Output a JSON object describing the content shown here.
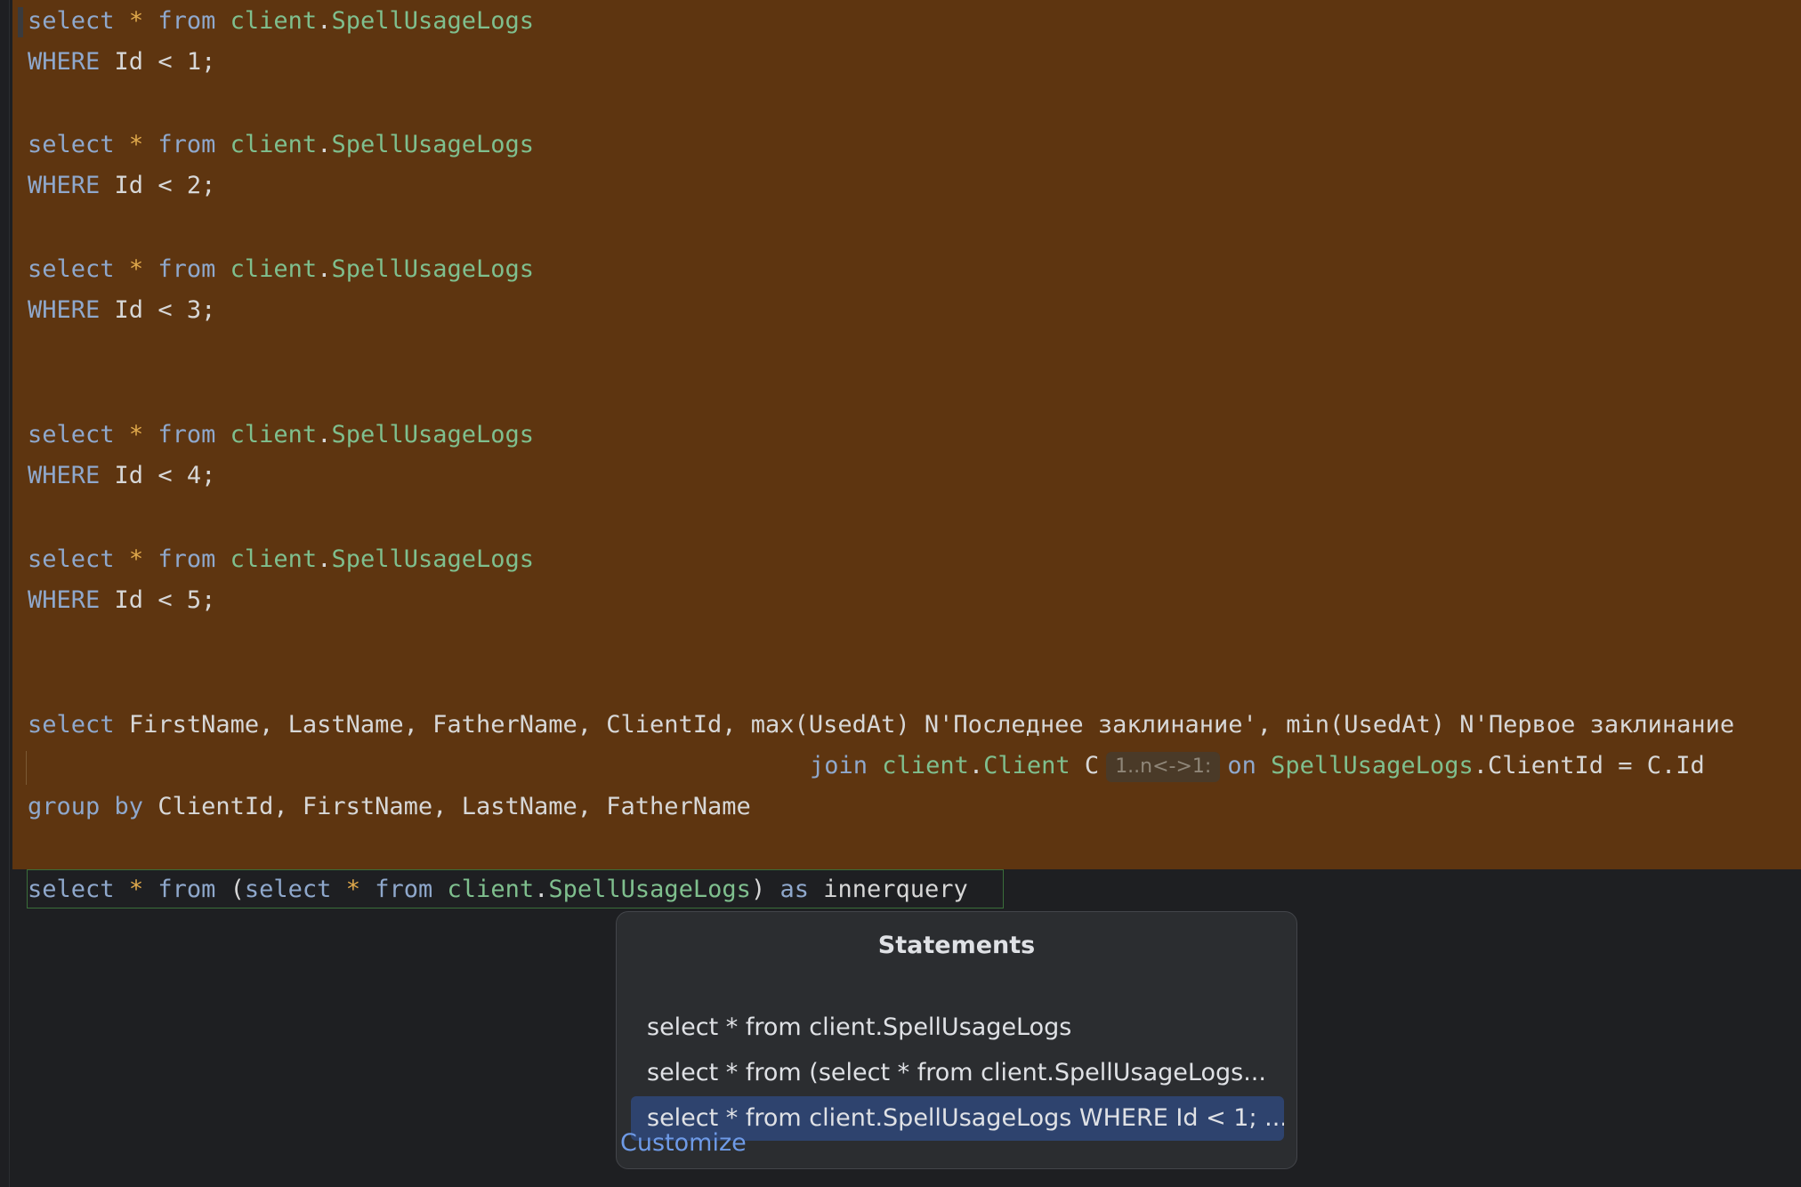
{
  "editor": {
    "lines": [
      {
        "kw1": "select",
        "star": "*",
        "kw2": "from",
        "schema": "client",
        "table": "SpellUsageLogs"
      },
      {
        "kw": "WHERE",
        "col": "Id",
        "op": "<",
        "val": "1;"
      },
      {
        "kw1": "select",
        "star": "*",
        "kw2": "from",
        "schema": "client",
        "table": "SpellUsageLogs"
      },
      {
        "kw": "WHERE",
        "col": "Id",
        "op": "<",
        "val": "2;"
      },
      {
        "kw1": "select",
        "star": "*",
        "kw2": "from",
        "schema": "client",
        "table": "SpellUsageLogs"
      },
      {
        "kw": "WHERE",
        "col": "Id",
        "op": "<",
        "val": "3;"
      },
      {
        "kw1": "select",
        "star": "*",
        "kw2": "from",
        "schema": "client",
        "table": "SpellUsageLogs"
      },
      {
        "kw": "WHERE",
        "col": "Id",
        "op": "<",
        "val": "4;"
      },
      {
        "kw1": "select",
        "star": "*",
        "kw2": "from",
        "schema": "client",
        "table": "SpellUsageLogs"
      },
      {
        "kw": "WHERE",
        "col": "Id",
        "op": "<",
        "val": "5;"
      }
    ],
    "group_query": {
      "select_kw": "select",
      "select_rest": "FirstName, LastName, FatherName, ClientId, max(UsedAt) N'Последнее заклинание', min(UsedAt) N'Первое заклинание",
      "join_kw": "join",
      "join_schema": "client",
      "join_table": "Client",
      "join_alias": "C",
      "join_hint": "1..n<->1:",
      "on_kw": "on",
      "on_left_table": "SpellUsageLogs",
      "on_rest": ".ClientId = C.Id",
      "group_kw1": "group",
      "group_kw2": "by",
      "group_rest": "ClientId, FirstName, LastName, FatherName"
    },
    "last_query": {
      "kw1": "select",
      "star1": "*",
      "kw2": "from",
      "paren_open": "(",
      "kw3": "select",
      "star2": "*",
      "kw4": "from",
      "schema": "client",
      "table": "SpellUsageLogs",
      "paren_close": ")",
      "as_kw": "as",
      "alias": "innerquery"
    }
  },
  "popup": {
    "title": "Statements",
    "items": [
      "select * from client.SpellUsageLogs",
      "select * from (select * from client.SpellUsageLogs...",
      "select * from client.SpellUsageLogs WHERE Id < 1; ..."
    ],
    "selected_index": 2,
    "customize_label": "Customize"
  }
}
